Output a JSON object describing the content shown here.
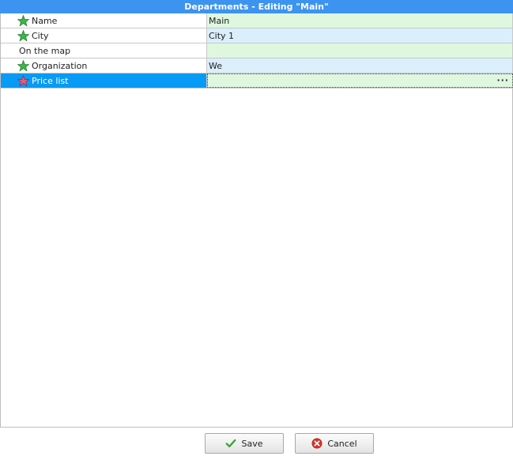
{
  "window": {
    "title": "Departments - Editing \"Main\""
  },
  "fields": [
    {
      "label": "Name",
      "value": "Main",
      "icon": "green-star-icon"
    },
    {
      "label": "City",
      "value": "City 1",
      "icon": "green-star-icon"
    },
    {
      "label": "On the map",
      "value": "",
      "icon": ""
    },
    {
      "label": "Organization",
      "value": "We",
      "icon": "green-star-icon"
    },
    {
      "label": "Price list",
      "value": "",
      "icon": "red-star-icon",
      "selected": true,
      "ellipsis": "···"
    }
  ],
  "buttons": {
    "save_label": "Save",
    "cancel_label": "Cancel"
  },
  "colors": {
    "title_bar": "#3d93f0",
    "selected_row": "#079bf5",
    "value_green": "#dff7df",
    "value_blue": "#dbeefb",
    "required_star": "#3cb54a",
    "required_star_pink": "#e85a7a"
  }
}
